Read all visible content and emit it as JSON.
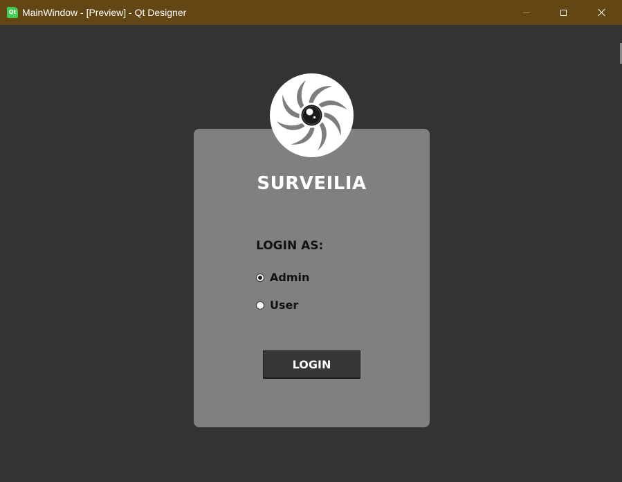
{
  "window": {
    "title": "MainWindow - [Preview] - Qt Designer",
    "app_icon_text": "Qt"
  },
  "login": {
    "app_title": "SURVEILIA",
    "login_as_label": "LOGIN AS:",
    "options": [
      {
        "label": "Admin",
        "checked": true
      },
      {
        "label": "User",
        "checked": false
      }
    ],
    "login_button_label": "LOGIN"
  },
  "colors": {
    "titlebar": "#624715",
    "background": "#333333",
    "card": "#808080",
    "button": "#363636"
  },
  "icons": {
    "app_icon": "qt-logo-icon",
    "logo": "camera-shutter-eye-icon"
  }
}
